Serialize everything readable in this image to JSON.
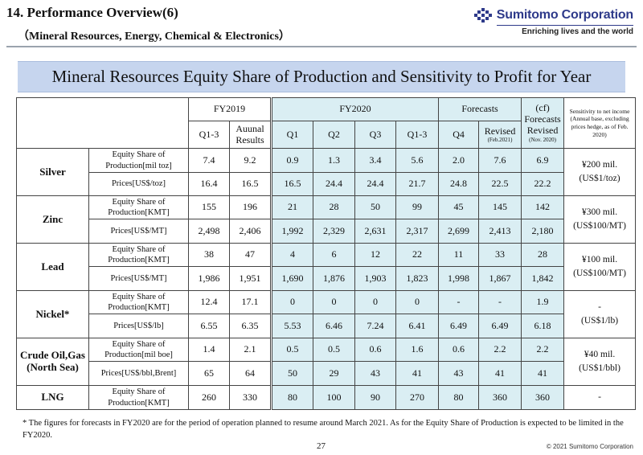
{
  "header": {
    "title": "14. Performance Overview(6)",
    "subtitle": "（Mineral Resources, Energy, Chemical & Electronics）",
    "logo_name": "Sumitomo Corporation",
    "logo_tagline": "Enriching lives and the world"
  },
  "banner": "Mineral Resources Equity Share of Production and Sensitivity to Profit for Year",
  "table": {
    "groups": {
      "fy2019": "FY2019",
      "fy2020": "FY2020",
      "forecasts": "Forecasts",
      "cf": "(cf)"
    },
    "cols": {
      "fy19_q13": "Q1-3",
      "fy19_annual": "Auunal Results",
      "q1": "Q1",
      "q2": "Q2",
      "q3": "Q3",
      "q13": "Q1-3",
      "q4": "Q4",
      "revised": "Revised",
      "revised_note": "(Feb.2021)",
      "cf_forecasts": "Forecasts",
      "cf_revised": "Revised",
      "cf_note": "(Nov. 2020)",
      "sensitivity": "Sensitivity to net income (Annual base, excluding prices hedge, as of Feb. 2020)"
    },
    "rows": {
      "silver": {
        "name": "Silver",
        "prod_label": "Equity Share of Production[mil toz]",
        "price_label": "Prices[US$/toz]",
        "prod": [
          "7.4",
          "9.2",
          "0.9",
          "1.3",
          "3.4",
          "5.6",
          "2.0",
          "7.6",
          "6.9"
        ],
        "price": [
          "16.4",
          "16.5",
          "16.5",
          "24.4",
          "24.4",
          "21.7",
          "24.8",
          "22.5",
          "22.2"
        ],
        "sens1": "¥200 mil.",
        "sens2": "(US$1/toz)"
      },
      "zinc": {
        "name": "Zinc",
        "prod_label": "Equity Share of Production[KMT]",
        "price_label": "Prices[US$/MT]",
        "prod": [
          "155",
          "196",
          "21",
          "28",
          "50",
          "99",
          "45",
          "145",
          "142"
        ],
        "price": [
          "2,498",
          "2,406",
          "1,992",
          "2,329",
          "2,631",
          "2,317",
          "2,699",
          "2,413",
          "2,180"
        ],
        "sens1": "¥300 mil.",
        "sens2": "(US$100/MT)"
      },
      "lead": {
        "name": "Lead",
        "prod_label": "Equity Share of Production[KMT]",
        "price_label": "Prices[US$/MT]",
        "prod": [
          "38",
          "47",
          "4",
          "6",
          "12",
          "22",
          "11",
          "33",
          "28"
        ],
        "price": [
          "1,986",
          "1,951",
          "1,690",
          "1,876",
          "1,903",
          "1,823",
          "1,998",
          "1,867",
          "1,842"
        ],
        "sens1": "¥100 mil.",
        "sens2": "(US$100/MT)"
      },
      "nickel": {
        "name": "Nickel*",
        "prod_label": "Equity Share of Production[KMT]",
        "price_label": "Prices[US$/lb]",
        "prod": [
          "12.4",
          "17.1",
          "0",
          "0",
          "0",
          "0",
          "-",
          "-",
          "1.9"
        ],
        "price": [
          "6.55",
          "6.35",
          "5.53",
          "6.46",
          "7.24",
          "6.41",
          "6.49",
          "6.49",
          "6.18"
        ],
        "sens1": "-",
        "sens2": "(US$1/lb)"
      },
      "crude": {
        "name1": "Crude Oil,Gas",
        "name2": "(North Sea)",
        "prod_label": "Equity Share of Production[mil boe]",
        "price_label": "Prices[US$/bbl,Brent]",
        "prod": [
          "1.4",
          "2.1",
          "0.5",
          "0.5",
          "0.6",
          "1.6",
          "0.6",
          "2.2",
          "2.2"
        ],
        "price": [
          "65",
          "64",
          "50",
          "29",
          "43",
          "41",
          "43",
          "41",
          "41"
        ],
        "sens1": "¥40 mil.",
        "sens2": "(US$1/bbl)"
      },
      "lng": {
        "name": "LNG",
        "prod_label": "Equity Share of Production[KMT]",
        "prod": [
          "260",
          "330",
          "80",
          "100",
          "90",
          "270",
          "80",
          "360",
          "360"
        ],
        "sens": "-"
      }
    }
  },
  "footnote": "* The figures for forecasts in FY2020 are for the period of operation planned to resume around March 2021. As for the Equity Share of Production is expected to be limited in the FY2020.",
  "page_number": "27",
  "copyright": "© 2021 Sumitomo Corporation"
}
